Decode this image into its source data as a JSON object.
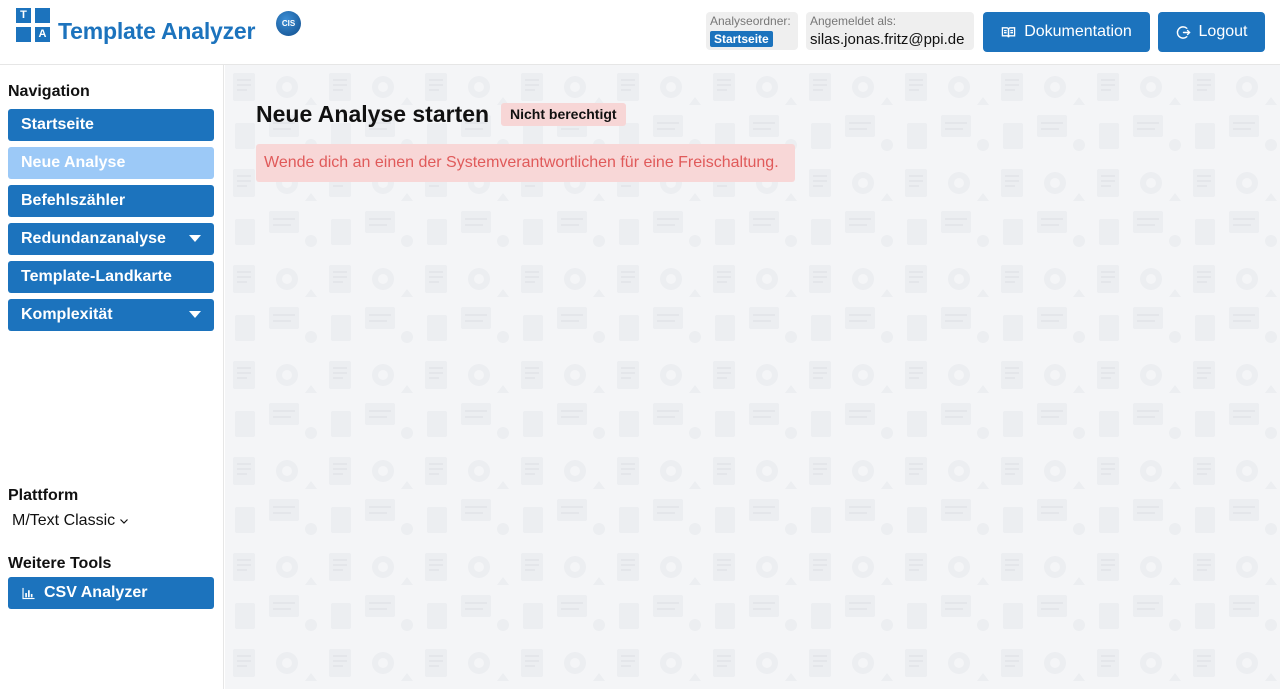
{
  "header": {
    "logo_letters": [
      "T",
      "A"
    ],
    "brand": "Template Analyzer",
    "cis_badge": "CIS",
    "folder_label": "Analyseordner:",
    "folder_value": "Startseite",
    "user_label": "Angemeldet als:",
    "user_email": "silas.jonas.fritz@ppi.de",
    "doc_button": "Dokumentation",
    "logout_button": "Logout"
  },
  "sidebar": {
    "nav_title": "Navigation",
    "items": [
      {
        "label": "Startseite"
      },
      {
        "label": "Neue Analyse"
      },
      {
        "label": "Befehlszähler"
      },
      {
        "label": "Redundanzanalyse"
      },
      {
        "label": "Template-Landkarte"
      },
      {
        "label": "Komplexität"
      }
    ],
    "platform_title": "Plattform",
    "platform_value": "M/Text Classic",
    "tools_title": "Weitere Tools",
    "tool_csv": "CSV Analyzer"
  },
  "main": {
    "title": "Neue Analyse starten",
    "badge": "Nicht berechtigt",
    "alert": "Wende dich an einen der Systemverantwortlichen für eine Freischaltung."
  },
  "colors": {
    "primary": "#1c73bd",
    "active": "#9cc9f7",
    "alert_bg": "#f8d7d7",
    "alert_text": "#e05a5a"
  }
}
